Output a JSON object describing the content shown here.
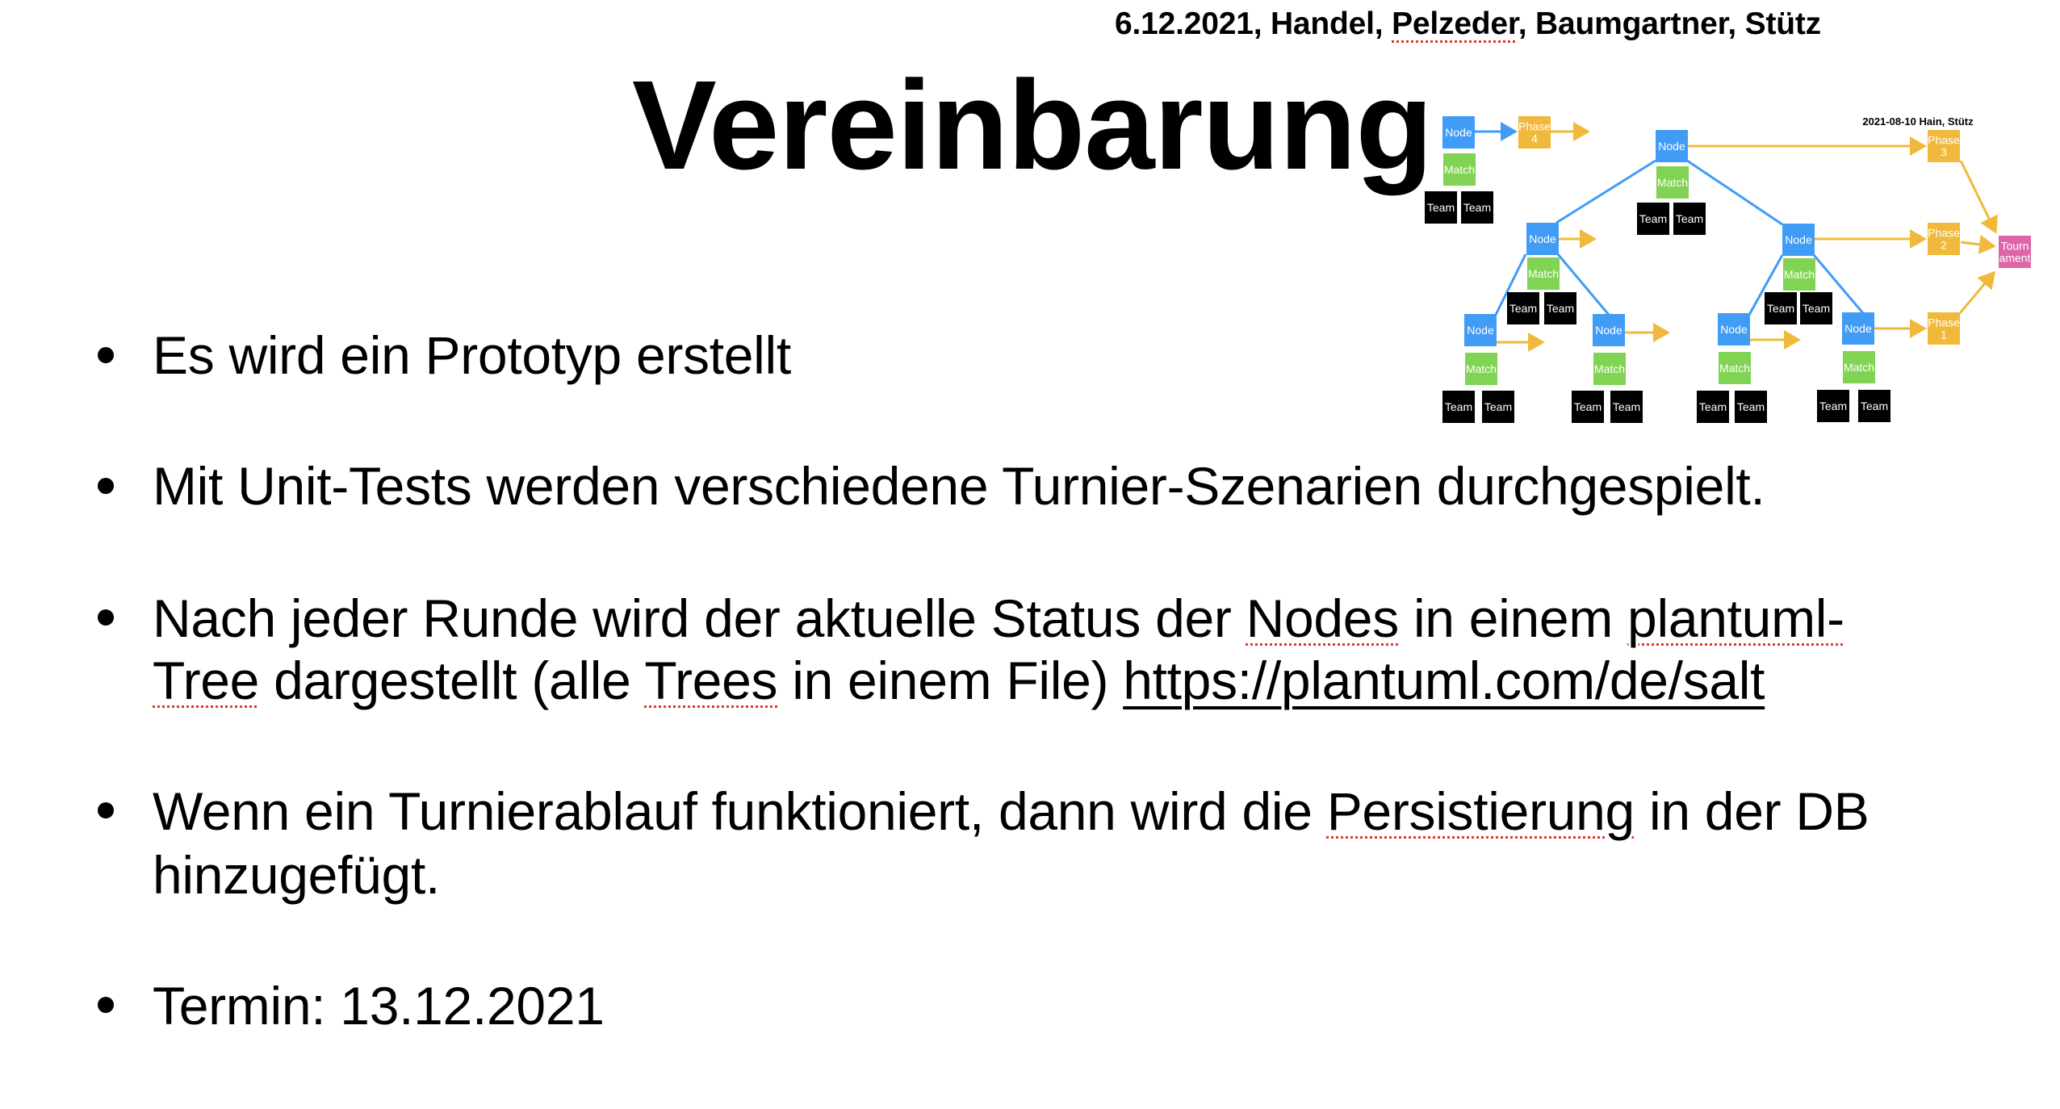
{
  "slide": {
    "header": "6.12.2021, Handel, Pelzeder,  Baumgartner, Stütz",
    "header_parts": [
      "6.12.2021, Handel, ",
      "Pelzeder",
      ",  Baumgartner, Stütz"
    ],
    "title": "Vereinbarung",
    "bullets": [
      {
        "lines": [
          {
            "parts": [
              "Es wird ein Prototyp erstellt"
            ]
          }
        ]
      },
      {
        "lines": [
          {
            "parts": [
              "Mit Unit-Tests werden verschiedene Turnier-Szenarien durchgespielt."
            ]
          }
        ]
      },
      {
        "lines": [
          {
            "parts": [
              "Nach jeder Runde wird der aktuelle Status der ",
              "Nodes",
              " in einem ",
              "plantuml-"
            ]
          },
          {
            "parts": [
              "Tree",
              " dargestellt (alle ",
              "Trees",
              " in einem File) ",
              "https://plantuml.com/de/salt"
            ]
          }
        ]
      },
      {
        "lines": [
          {
            "parts": [
              "Wenn ein Turnierablauf funktioniert, dann wird die ",
              "Persistierung",
              " in der DB"
            ]
          },
          {
            "parts": [
              "hinzugefügt."
            ]
          }
        ]
      },
      {
        "lines": [
          {
            "parts": [
              "Termin: 13.12.2021"
            ]
          }
        ]
      }
    ],
    "link_url": "https://plantuml.com/de/salt"
  },
  "diagram": {
    "caption": "2021-08-10 Hain, Stütz",
    "labels": {
      "node": "Node",
      "match": "Match",
      "team": "Team",
      "phase_word": "Phase",
      "tournament_line1": "Tourn",
      "tournament_line2": "ament"
    },
    "phases": [
      "4",
      "3",
      "2",
      "1"
    ],
    "colors": {
      "node": "#419cf5",
      "match": "#80d353",
      "team": "#000000",
      "phase": "#f0b93b",
      "tournament": "#dd65a9",
      "tree_edge": "#419cf5",
      "phase_arrow": "#f0b93b"
    }
  }
}
